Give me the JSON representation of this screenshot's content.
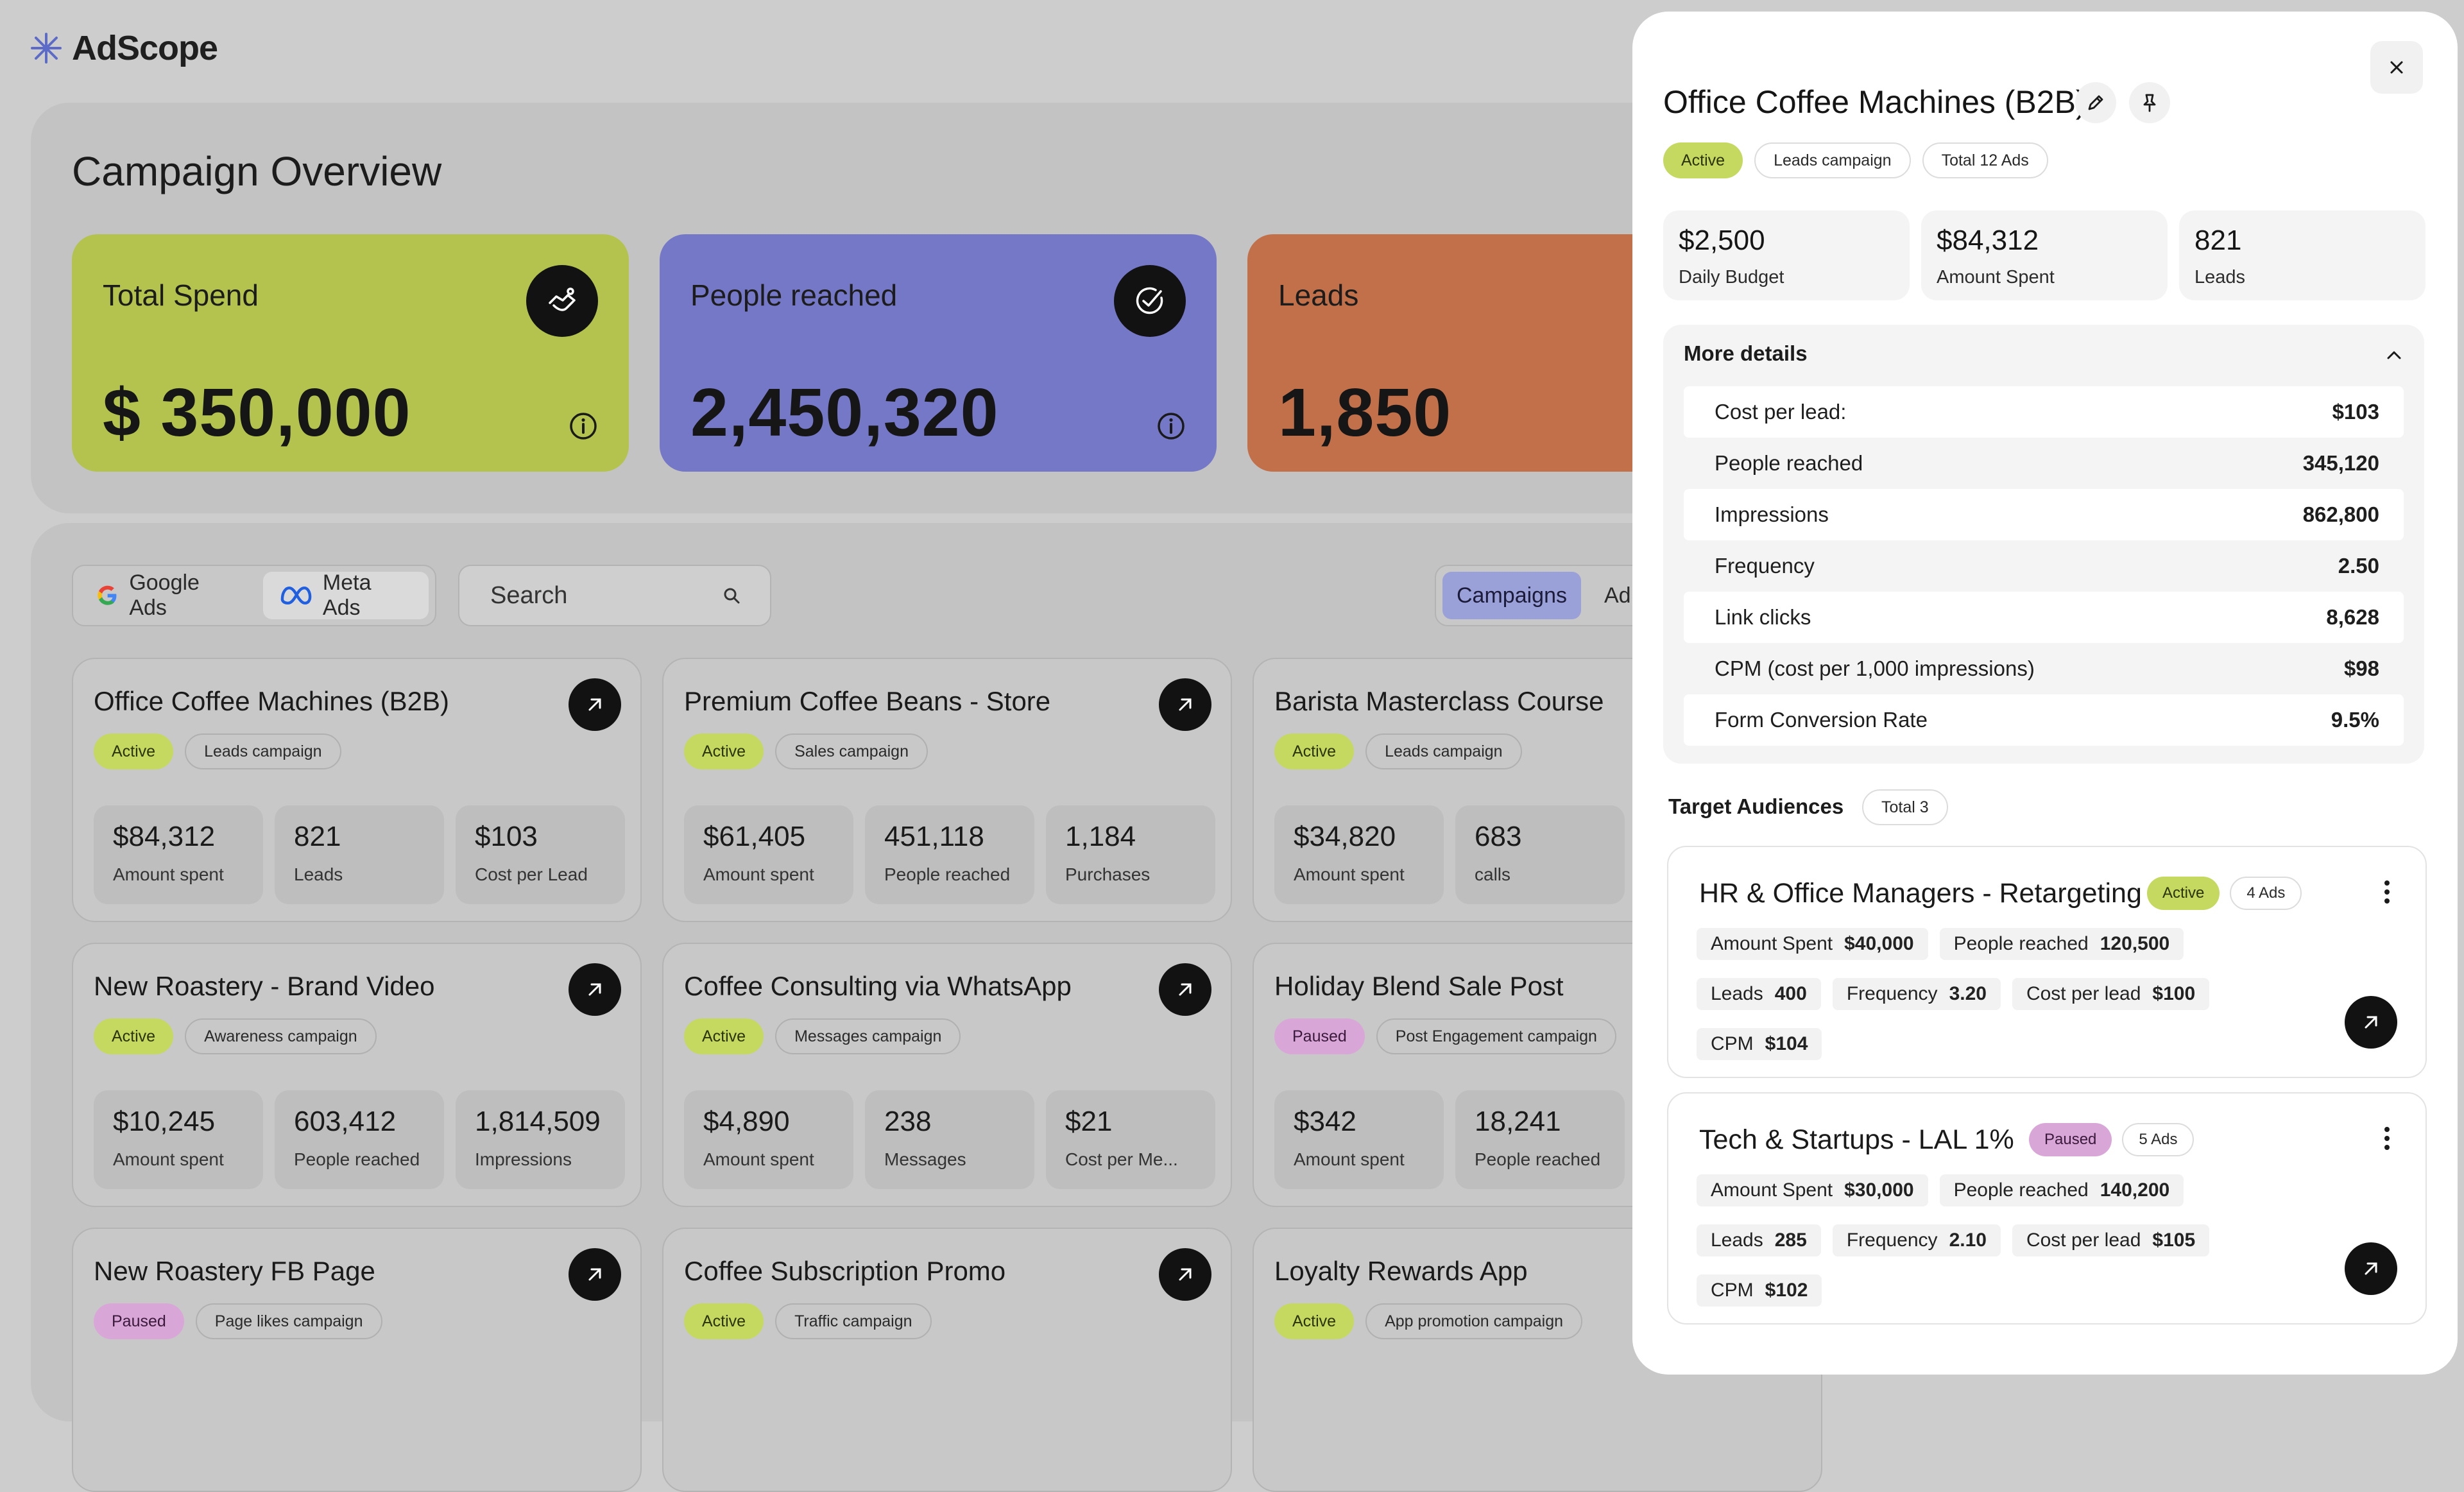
{
  "app": {
    "name": "AdScope"
  },
  "overview": {
    "title": "Campaign Overview",
    "cards": [
      {
        "label": "Total Spend",
        "value": "$ 350,000",
        "color": "#b4c34e"
      },
      {
        "label": "People reached",
        "value": "2,450,320",
        "color": "#7478c6"
      },
      {
        "label": "Leads",
        "value": "1,850",
        "color": "#c2704a"
      }
    ]
  },
  "filters": {
    "platforms": [
      "Google Ads",
      "Meta Ads"
    ],
    "search_placeholder": "Search",
    "views": [
      "Campaigns",
      "Ad"
    ]
  },
  "campaigns": [
    {
      "name": "Office Coffee Machines (B2B)",
      "status": "Active",
      "type": "Leads campaign",
      "metrics": [
        {
          "value": "$84,312",
          "label": "Amount spent"
        },
        {
          "value": "821",
          "label": "Leads"
        },
        {
          "value": "$103",
          "label": "Cost per Lead"
        }
      ]
    },
    {
      "name": "Premium Coffee Beans - Store",
      "status": "Active",
      "type": "Sales campaign",
      "metrics": [
        {
          "value": "$61,405",
          "label": "Amount spent"
        },
        {
          "value": "451,118",
          "label": "People reached"
        },
        {
          "value": "1,184",
          "label": "Purchases"
        }
      ]
    },
    {
      "name": "Barista Masterclass Course",
      "status": "Active",
      "type": "Leads campaign",
      "metrics": [
        {
          "value": "$34,820",
          "label": "Amount spent"
        },
        {
          "value": "683",
          "label": "calls"
        },
        {
          "value": "",
          "label": ""
        }
      ]
    },
    {
      "name": "New Roastery - Brand Video",
      "status": "Active",
      "type": "Awareness campaign",
      "metrics": [
        {
          "value": "$10,245",
          "label": "Amount spent"
        },
        {
          "value": "603,412",
          "label": "People reached"
        },
        {
          "value": "1,814,509",
          "label": "Impressions"
        }
      ]
    },
    {
      "name": "Coffee Consulting via WhatsApp",
      "status": "Active",
      "type": "Messages campaign",
      "metrics": [
        {
          "value": "$4,890",
          "label": "Amount spent"
        },
        {
          "value": "238",
          "label": "Messages"
        },
        {
          "value": "$21",
          "label": "Cost per Me..."
        }
      ]
    },
    {
      "name": "Holiday Blend Sale Post",
      "status": "Paused",
      "type": "Post Engagement campaign",
      "metrics": [
        {
          "value": "$342",
          "label": "Amount spent"
        },
        {
          "value": "18,241",
          "label": "People reached"
        },
        {
          "value": "",
          "label": ""
        }
      ]
    },
    {
      "name": "New Roastery FB Page",
      "status": "Paused",
      "type": "Page likes campaign",
      "metrics": []
    },
    {
      "name": "Coffee Subscription Promo",
      "status": "Active",
      "type": "Traffic campaign",
      "metrics": []
    },
    {
      "name": "Loyalty Rewards App",
      "status": "Active",
      "type": "App promotion campaign",
      "metrics": []
    }
  ],
  "detail": {
    "title": "Office Coffee Machines (B2B)",
    "tags": [
      "Active",
      "Leads campaign",
      "Total 12 Ads"
    ],
    "kpis": [
      {
        "value": "$2,500",
        "label": "Daily Budget"
      },
      {
        "value": "$84,312",
        "label": "Amount Spent"
      },
      {
        "value": "821",
        "label": "Leads"
      }
    ],
    "more_details": {
      "title": "More details",
      "rows": [
        {
          "label": "Cost per lead:",
          "value": "$103"
        },
        {
          "label": "People reached",
          "value": "345,120"
        },
        {
          "label": "Impressions",
          "value": "862,800"
        },
        {
          "label": "Frequency",
          "value": "2.50"
        },
        {
          "label": "Link clicks",
          "value": "8,628"
        },
        {
          "label": "CPM (cost per 1,000 impressions)",
          "value": "$98"
        },
        {
          "label": "Form Conversion Rate",
          "value": "9.5%"
        }
      ]
    },
    "audiences_title": "Target Audiences",
    "audiences_total": "Total 3",
    "audiences": [
      {
        "name": "HR & Office Managers - Retargeting",
        "status": "Active",
        "ads": "4 Ads",
        "chips": [
          {
            "k": "Amount Spent",
            "v": "$40,000"
          },
          {
            "k": "People reached",
            "v": "120,500"
          },
          {
            "k": "Leads",
            "v": "400"
          },
          {
            "k": "Frequency",
            "v": "3.20"
          },
          {
            "k": "Cost per lead",
            "v": "$100"
          },
          {
            "k": "CPM",
            "v": "$104"
          }
        ]
      },
      {
        "name": "Tech & Startups - LAL 1%",
        "status": "Paused",
        "ads": "5 Ads",
        "chips": [
          {
            "k": "Amount Spent",
            "v": "$30,000"
          },
          {
            "k": "People reached",
            "v": "140,200"
          },
          {
            "k": "Leads",
            "v": "285"
          },
          {
            "k": "Frequency",
            "v": "2.10"
          },
          {
            "k": "Cost per lead",
            "v": "$105"
          },
          {
            "k": "CPM",
            "v": "$102"
          }
        ]
      }
    ]
  },
  "colors": {
    "active": "#c5d860",
    "paused": "#d9a6d8",
    "selected_view": "#9aa0d8"
  }
}
